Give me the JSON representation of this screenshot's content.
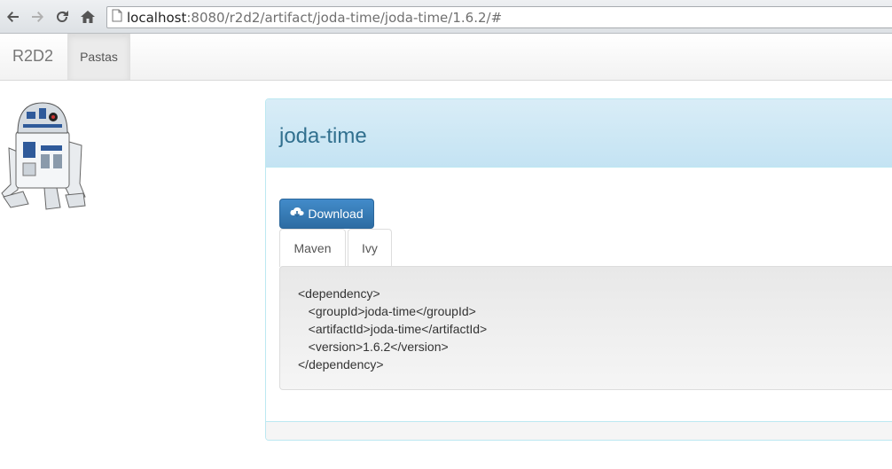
{
  "browser": {
    "url_host": "localhost",
    "url_rest": ":8080/r2d2/artifact/joda-time/joda-time/1.6.2/#",
    "icons": [
      "back-icon",
      "forward-icon",
      "reload-icon",
      "home-icon",
      "page-icon"
    ]
  },
  "navbar": {
    "brand": "R2D2",
    "items": [
      {
        "label": "Pastas",
        "active": true
      }
    ]
  },
  "logo": {
    "icon": "r2d2-robot-image"
  },
  "panel": {
    "title": "joda-time",
    "download_label": "Download",
    "download_icon": "cloud-download-icon",
    "tabs": [
      {
        "label": "Maven",
        "active": true
      },
      {
        "label": "Ivy",
        "active": false
      }
    ],
    "code_lines": [
      "<dependency>",
      "   <groupId>joda-time</groupId>",
      "   <artifactId>joda-time</artifactId>",
      "   <version>1.6.2</version>",
      "</dependency>"
    ]
  },
  "colors": {
    "panel_heading": "#d9edf7",
    "panel_title": "#31708f",
    "primary_button": "#428bca"
  }
}
